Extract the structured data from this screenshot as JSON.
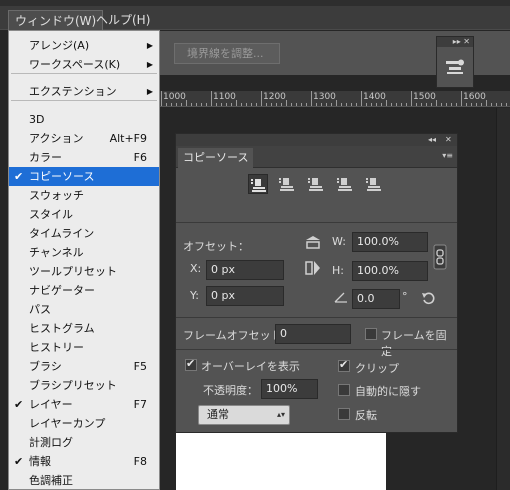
{
  "menubar": {
    "window_label": "ウィンドウ(W)",
    "help_label": "ヘルプ(H)"
  },
  "options_bar": {
    "border_button_label": "境界線を調整..."
  },
  "ruler": {
    "labels": [
      "1000",
      "1100",
      "1200",
      "1300",
      "1400",
      "1500",
      "1600"
    ]
  },
  "window_menu": {
    "items": [
      {
        "label": "アレンジ(A)",
        "submenu": true
      },
      {
        "label": "ワークスペース(K)",
        "submenu": true
      },
      {
        "label": "エクステンション",
        "submenu": true
      },
      {
        "label": "3D"
      },
      {
        "label": "アクション",
        "shortcut": "Alt+F9"
      },
      {
        "label": "カラー",
        "shortcut": "F6"
      },
      {
        "label": "コピーソース",
        "checked": true,
        "highlighted": true
      },
      {
        "label": "スウォッチ"
      },
      {
        "label": "スタイル"
      },
      {
        "label": "タイムライン"
      },
      {
        "label": "チャンネル"
      },
      {
        "label": "ツールプリセット"
      },
      {
        "label": "ナビゲーター"
      },
      {
        "label": "パス"
      },
      {
        "label": "ヒストグラム"
      },
      {
        "label": "ヒストリー"
      },
      {
        "label": "ブラシ",
        "shortcut": "F5"
      },
      {
        "label": "ブラシプリセット"
      },
      {
        "label": "レイヤー",
        "shortcut": "F7",
        "checked": true
      },
      {
        "label": "レイヤーカンプ"
      },
      {
        "label": "計測ログ"
      },
      {
        "label": "情報",
        "shortcut": "F8",
        "checked": true
      },
      {
        "label": "色調補正"
      }
    ],
    "check_glyph": "✔",
    "arrow_glyph": "▶"
  },
  "clone_panel": {
    "title": "コピーソース",
    "collapse_glyph": "◂◂",
    "close_glyph": "✕",
    "menu_glyph": "▾≡",
    "offset_label": "オフセット：",
    "x_label": "X:",
    "x_value": "0 px",
    "y_label": "Y:",
    "y_value": "0 px",
    "w_label": "W:",
    "w_value": "100.0%",
    "h_label": "H:",
    "h_value": "100.0%",
    "angle_value": "0.0",
    "degree_symbol": "°",
    "frame_offset_label": "フレームオフセット：",
    "frame_offset_value": "0",
    "lock_frame_label": "フレームを固定",
    "show_overlay_label": "オーバーレイを表示",
    "opacity_label": "不透明度：",
    "opacity_value": "100%",
    "clip_label": "クリップ",
    "auto_hide_label": "自動的に隠す",
    "invert_label": "反転",
    "blend_mode_value": "通常",
    "checkboxes": {
      "lock_frame": false,
      "show_overlay": true,
      "clip": true,
      "auto_hide": false,
      "invert": false
    }
  },
  "mini_panel": {
    "controls": "▸▸ ✕"
  },
  "colors": {
    "menu_highlight": "#1e6ed6",
    "panel_bg": "#535353",
    "app_bg": "#262626"
  }
}
